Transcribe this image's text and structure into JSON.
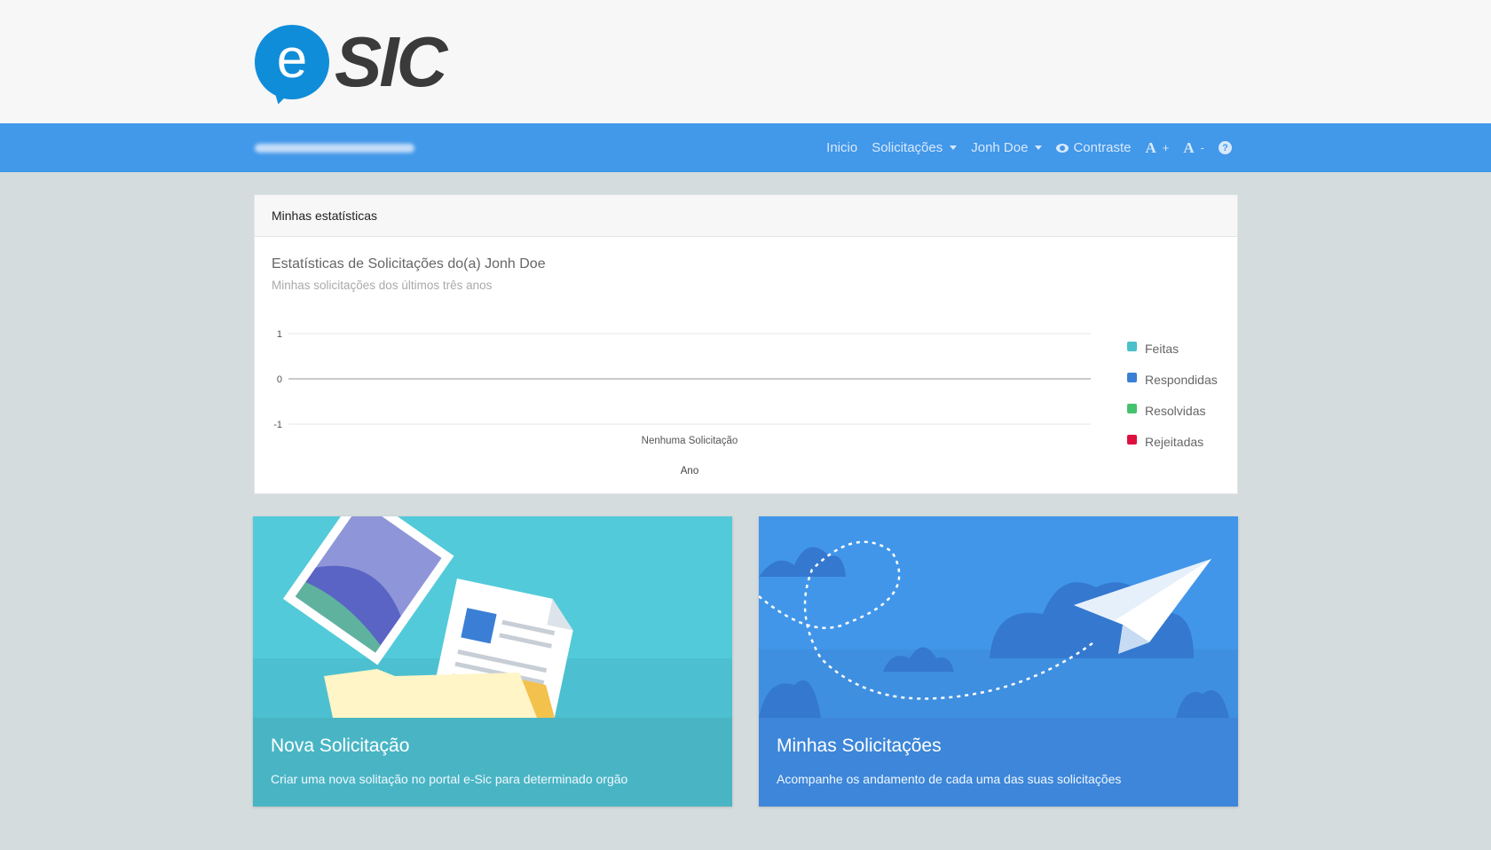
{
  "logo": {
    "e": "e",
    "sic": "SIC"
  },
  "nav": {
    "items": [
      {
        "label": "Inicio",
        "dropdown": false
      },
      {
        "label": "Solicitações",
        "dropdown": true
      },
      {
        "label": "Jonh Doe",
        "dropdown": true
      },
      {
        "label": "Contraste",
        "icon": "eye-icon"
      },
      {
        "label": "A",
        "suffix": "+",
        "icon": "font-increase-icon"
      },
      {
        "label": "A",
        "suffix": "-",
        "icon": "font-decrease-icon"
      },
      {
        "label": "?",
        "icon": "help-icon"
      }
    ]
  },
  "stats": {
    "header": "Minhas estatísticas"
  },
  "chart_data": {
    "type": "bar",
    "title": "Estatísticas de Solicitações do(a) Jonh Doe",
    "subtitle": "Minhas solicitações dos últimos três anos",
    "categories": [
      "Nenhuma Solicitação"
    ],
    "xlabel": "Ano",
    "ylabel": "",
    "ylim": [
      -1,
      1
    ],
    "yticks": [
      "1",
      "0",
      "-1"
    ],
    "series": [
      {
        "name": "Feitas",
        "color": "#4bc0c8",
        "values": [
          0
        ]
      },
      {
        "name": "Respondidas",
        "color": "#3a7fd5",
        "values": [
          0
        ]
      },
      {
        "name": "Resolvidas",
        "color": "#44c26e",
        "values": [
          0
        ]
      },
      {
        "name": "Rejeitadas",
        "color": "#e0103e",
        "values": [
          0
        ]
      }
    ],
    "legend": "right",
    "grid": true
  },
  "tiles": [
    {
      "title": "Nova Solicitação",
      "description": "Criar uma nova solitação no portal e-Sic para determinado orgão"
    },
    {
      "title": "Minhas Solicitações",
      "description": "Acompanhe os andamento de cada uma das suas solicitações"
    }
  ],
  "colors": {
    "navbar": "#4298e9",
    "brand": "#0f8dd9",
    "tile1": "#49b5c4",
    "tile2": "#3d86d9"
  }
}
